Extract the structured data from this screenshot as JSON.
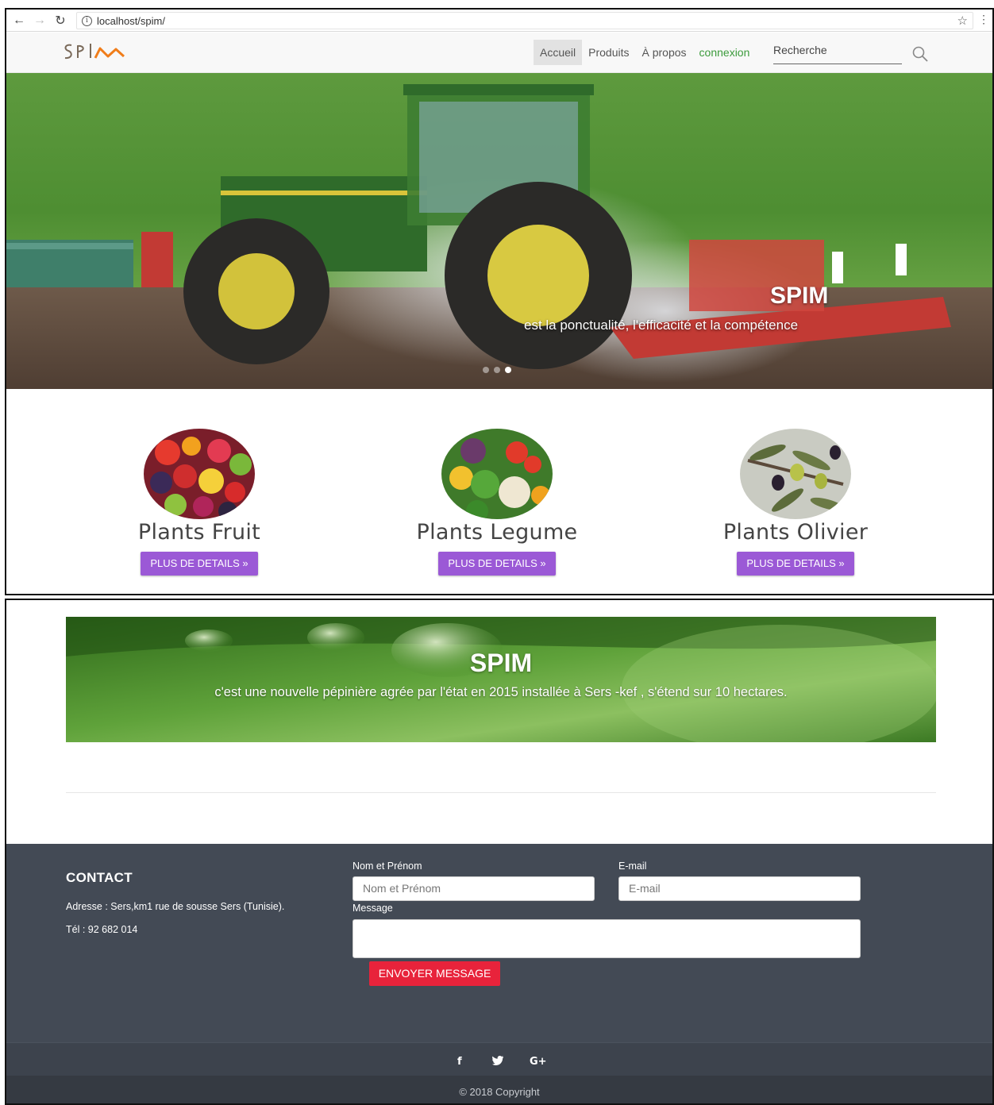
{
  "browser": {
    "url": "localhost/spim/",
    "back_icon": "back-arrow-icon",
    "forward_icon": "forward-arrow-icon",
    "reload_icon": "reload-icon",
    "info_icon": "info-icon",
    "bookmark_icon": "star-icon"
  },
  "site": {
    "logo_text": "SPIM",
    "nav": [
      {
        "label": "Accueil",
        "active": true
      },
      {
        "label": "Produits"
      },
      {
        "label": "À propos"
      },
      {
        "label": "connexion"
      }
    ],
    "search": {
      "text": "Recherche",
      "icon": "search-icon"
    }
  },
  "hero": {
    "title": "SPIM",
    "subtitle": "est la ponctualité, l'efficacité et la compétence",
    "slides": 3,
    "active_slide": 3
  },
  "products": [
    {
      "title": "Plants Fruit",
      "button": "PLUS DE DETAILS »"
    },
    {
      "title": "Plants Legume",
      "button": "PLUS DE DETAILS »"
    },
    {
      "title": "Plants Olivier",
      "button": "PLUS DE DETAILS »"
    }
  ],
  "about": {
    "title": "SPIM",
    "text": "c'est une nouvelle pépinière agrée par l'état en 2015 installée à Sers -kef , s'étend sur 10 hectares."
  },
  "footer": {
    "contact_title": "CONTACT",
    "address": "Adresse : Sers,km1 rue de sousse Sers (Tunisie).",
    "phone": "Tél : 92 682 014",
    "form": {
      "name_label": "Nom et Prénom",
      "name_placeholder": "Nom et Prénom",
      "email_label": "E-mail",
      "email_placeholder": "E-mail",
      "message_label": "Message",
      "submit": "ENVOYER MESSAGE"
    },
    "social": [
      "f",
      "t",
      "G+"
    ],
    "copyright": "© 2018 Copyright"
  },
  "colors": {
    "accent_purple": "#9b59d6",
    "send_red": "#e8233b",
    "footer_bg": "#434a55",
    "nav_green": "#3c9b3c"
  }
}
